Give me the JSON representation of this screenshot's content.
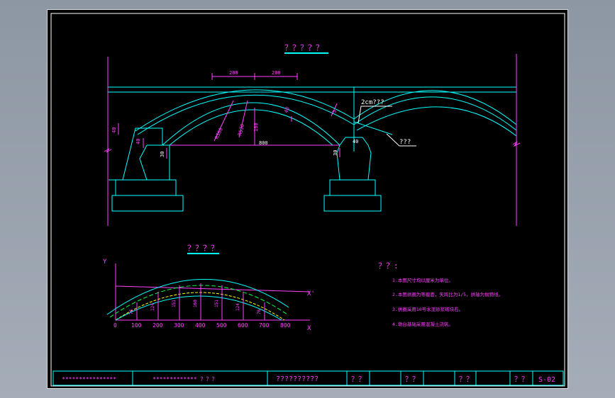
{
  "drawing": {
    "elevation_title": "？？？？？",
    "arch_title": "？？？？",
    "notes_title": "？？:",
    "notes": [
      "1.本图尺寸均以厘米为单位。",
      "2.本图拱圈为等截面，矢跨比为1/5，拱轴为抛物线。",
      "3.拱圈采用10号水泥砂浆砌块石。",
      "4.墩台基础采用混凝土浇筑。"
    ]
  },
  "elevation": {
    "dim_top_left": "200",
    "dim_top_right": "200",
    "span_label": "800",
    "rise_label": "160",
    "thickness_label": "40",
    "label_r1": "R560",
    "label_r2": "R530",
    "label_30": "30",
    "label_5": "5",
    "label_40a": "40",
    "label_40b": "40",
    "label_30b": "30",
    "label_30c": "30",
    "label_40c": "40",
    "callout_pavement": "2cm???",
    "callout_fill": "???"
  },
  "arch": {
    "y_axis": "Y",
    "x_axis": "X",
    "x_prime": "X'",
    "x_ticks": [
      "0",
      "100",
      "200",
      "300",
      "400",
      "500",
      "600",
      "700",
      "800"
    ],
    "ordinates": [
      "76",
      "124",
      "151",
      "160",
      "151",
      "124",
      "76"
    ]
  },
  "title_block": {
    "cell1": "****************",
    "cell2": "*************  ？？？",
    "cell3": "??????????",
    "cell4": "？？",
    "cell5": "？？",
    "cell6": "？？",
    "cell7": "？？",
    "cell8": "S-02"
  }
}
